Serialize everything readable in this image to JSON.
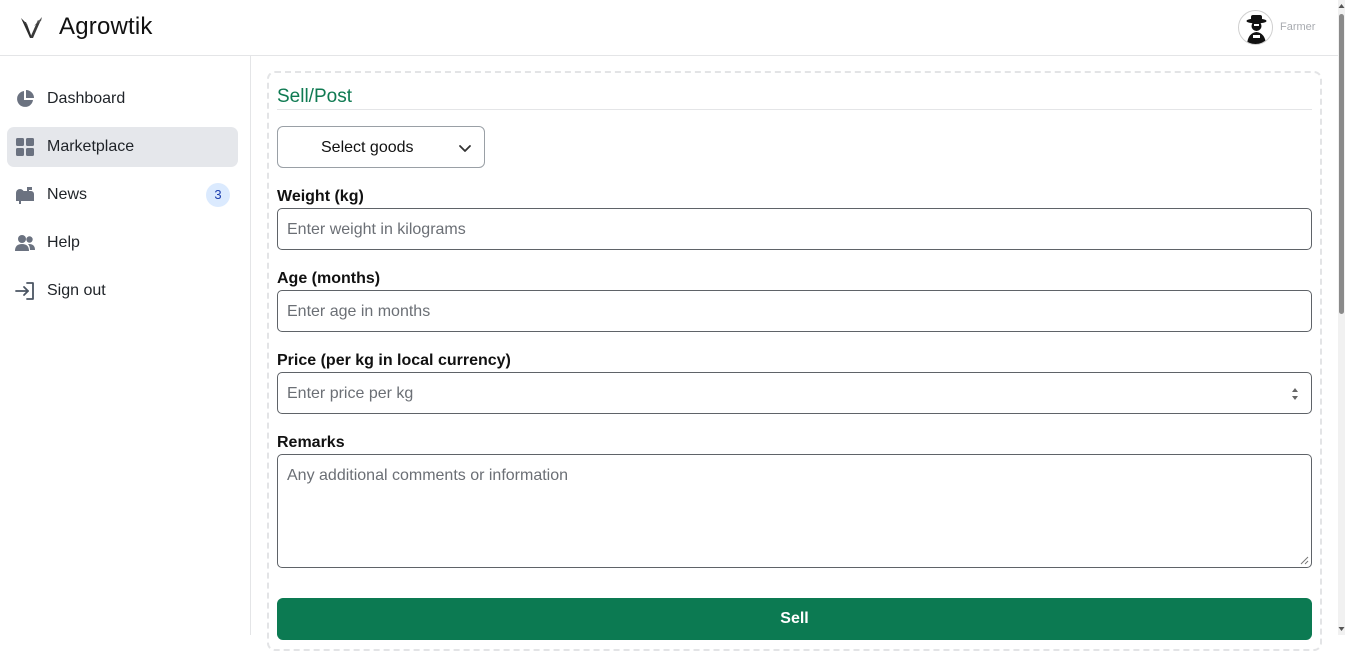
{
  "app": {
    "name": "Agrowtik",
    "role": "Farmer"
  },
  "colors": {
    "accent": "#0c7a52",
    "title": "#0f7a52",
    "active_nav_bg": "#e5e7eb",
    "badge_bg": "#dbeafe"
  },
  "sidebar": {
    "items": [
      {
        "label": "Dashboard",
        "icon": "pie-chart-icon"
      },
      {
        "label": "Marketplace",
        "icon": "grid-icon",
        "active": true
      },
      {
        "label": "News",
        "icon": "mailbox-icon",
        "badge": "3"
      },
      {
        "label": "Help",
        "icon": "users-icon"
      },
      {
        "label": "Sign out",
        "icon": "sign-out-icon"
      }
    ]
  },
  "form": {
    "title": "Sell/Post",
    "goods_select": {
      "value": "Select goods"
    },
    "weight": {
      "label": "Weight (kg)",
      "placeholder": "Enter weight in kilograms"
    },
    "age": {
      "label": "Age (months)",
      "placeholder": "Enter age in months"
    },
    "price": {
      "label": "Price (per kg in local currency)",
      "placeholder": "Enter price per kg"
    },
    "remarks": {
      "label": "Remarks",
      "placeholder": "Any additional comments or information"
    },
    "submit_label": "Sell"
  }
}
